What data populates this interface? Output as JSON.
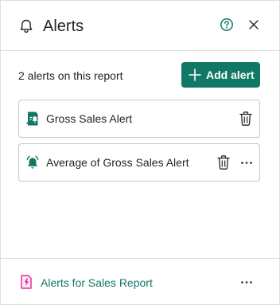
{
  "header": {
    "icon": "bell-icon",
    "title": "Alerts",
    "help_icon": "question-circle-icon",
    "close_icon": "close-icon"
  },
  "summary": {
    "count_text": "2 alerts on this report",
    "add_button_label": "Add alert",
    "add_button_icon": "plus-icon"
  },
  "alerts": [
    {
      "name": "Gross Sales Alert",
      "icon": "report-bell-icon",
      "actions": [
        "trash-icon"
      ]
    },
    {
      "name": "Average of Gross Sales Alert",
      "icon": "alarm-bell-icon",
      "actions": [
        "trash-icon",
        "more-icon"
      ]
    }
  ],
  "footer": {
    "icon": "report-icon",
    "link_text": "Alerts for Sales Report",
    "more_icon": "more-icon"
  },
  "colors": {
    "accent": "#117865",
    "text": "#252423",
    "border": "#c8c6c4",
    "divider": "#e1dfdd",
    "report_icon": "#e3008c"
  }
}
